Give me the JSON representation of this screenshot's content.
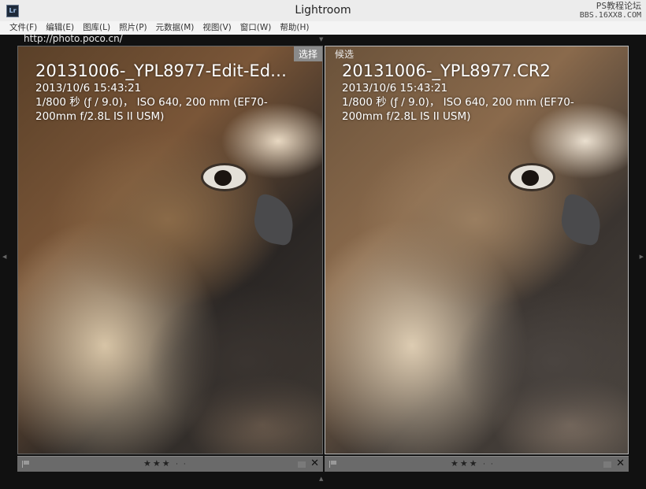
{
  "window": {
    "title": "Lightroom",
    "logo_text": "Lr",
    "watermark_line1": "PS教程论坛",
    "watermark_line2": "BBS.16XX8.COM"
  },
  "menu": {
    "items": [
      "文件(F)",
      "编辑(E)",
      "图库(L)",
      "照片(P)",
      "元数据(M)",
      "视图(V)",
      "窗口(W)",
      "帮助(H)"
    ]
  },
  "main": {
    "url_label": "http://photo.poco.cn/"
  },
  "panes": [
    {
      "tag": "选择",
      "filename": "20131006-_YPL8977-Edit-Ed…",
      "datetime": "2013/10/6 15:43:21",
      "exif": "1/800 秒 (ƒ / 9.0)， ISO 640, 200 mm (EF70-200mm f/2.8L IS II USM)",
      "stars": "★★★",
      "dots": "· ·"
    },
    {
      "tag": "候选",
      "filename": "20131006-_YPL8977.CR2",
      "datetime": "2013/10/6 15:43:21",
      "exif": "1/800 秒 (ƒ / 9.0)， ISO 640, 200 mm (EF70-200mm f/2.8L IS II USM)",
      "stars": "★★★",
      "dots": "· ·"
    }
  ],
  "controls": {
    "close_glyph": "✕"
  },
  "ratings": {
    "left_stars": 3,
    "right_stars": 3
  }
}
